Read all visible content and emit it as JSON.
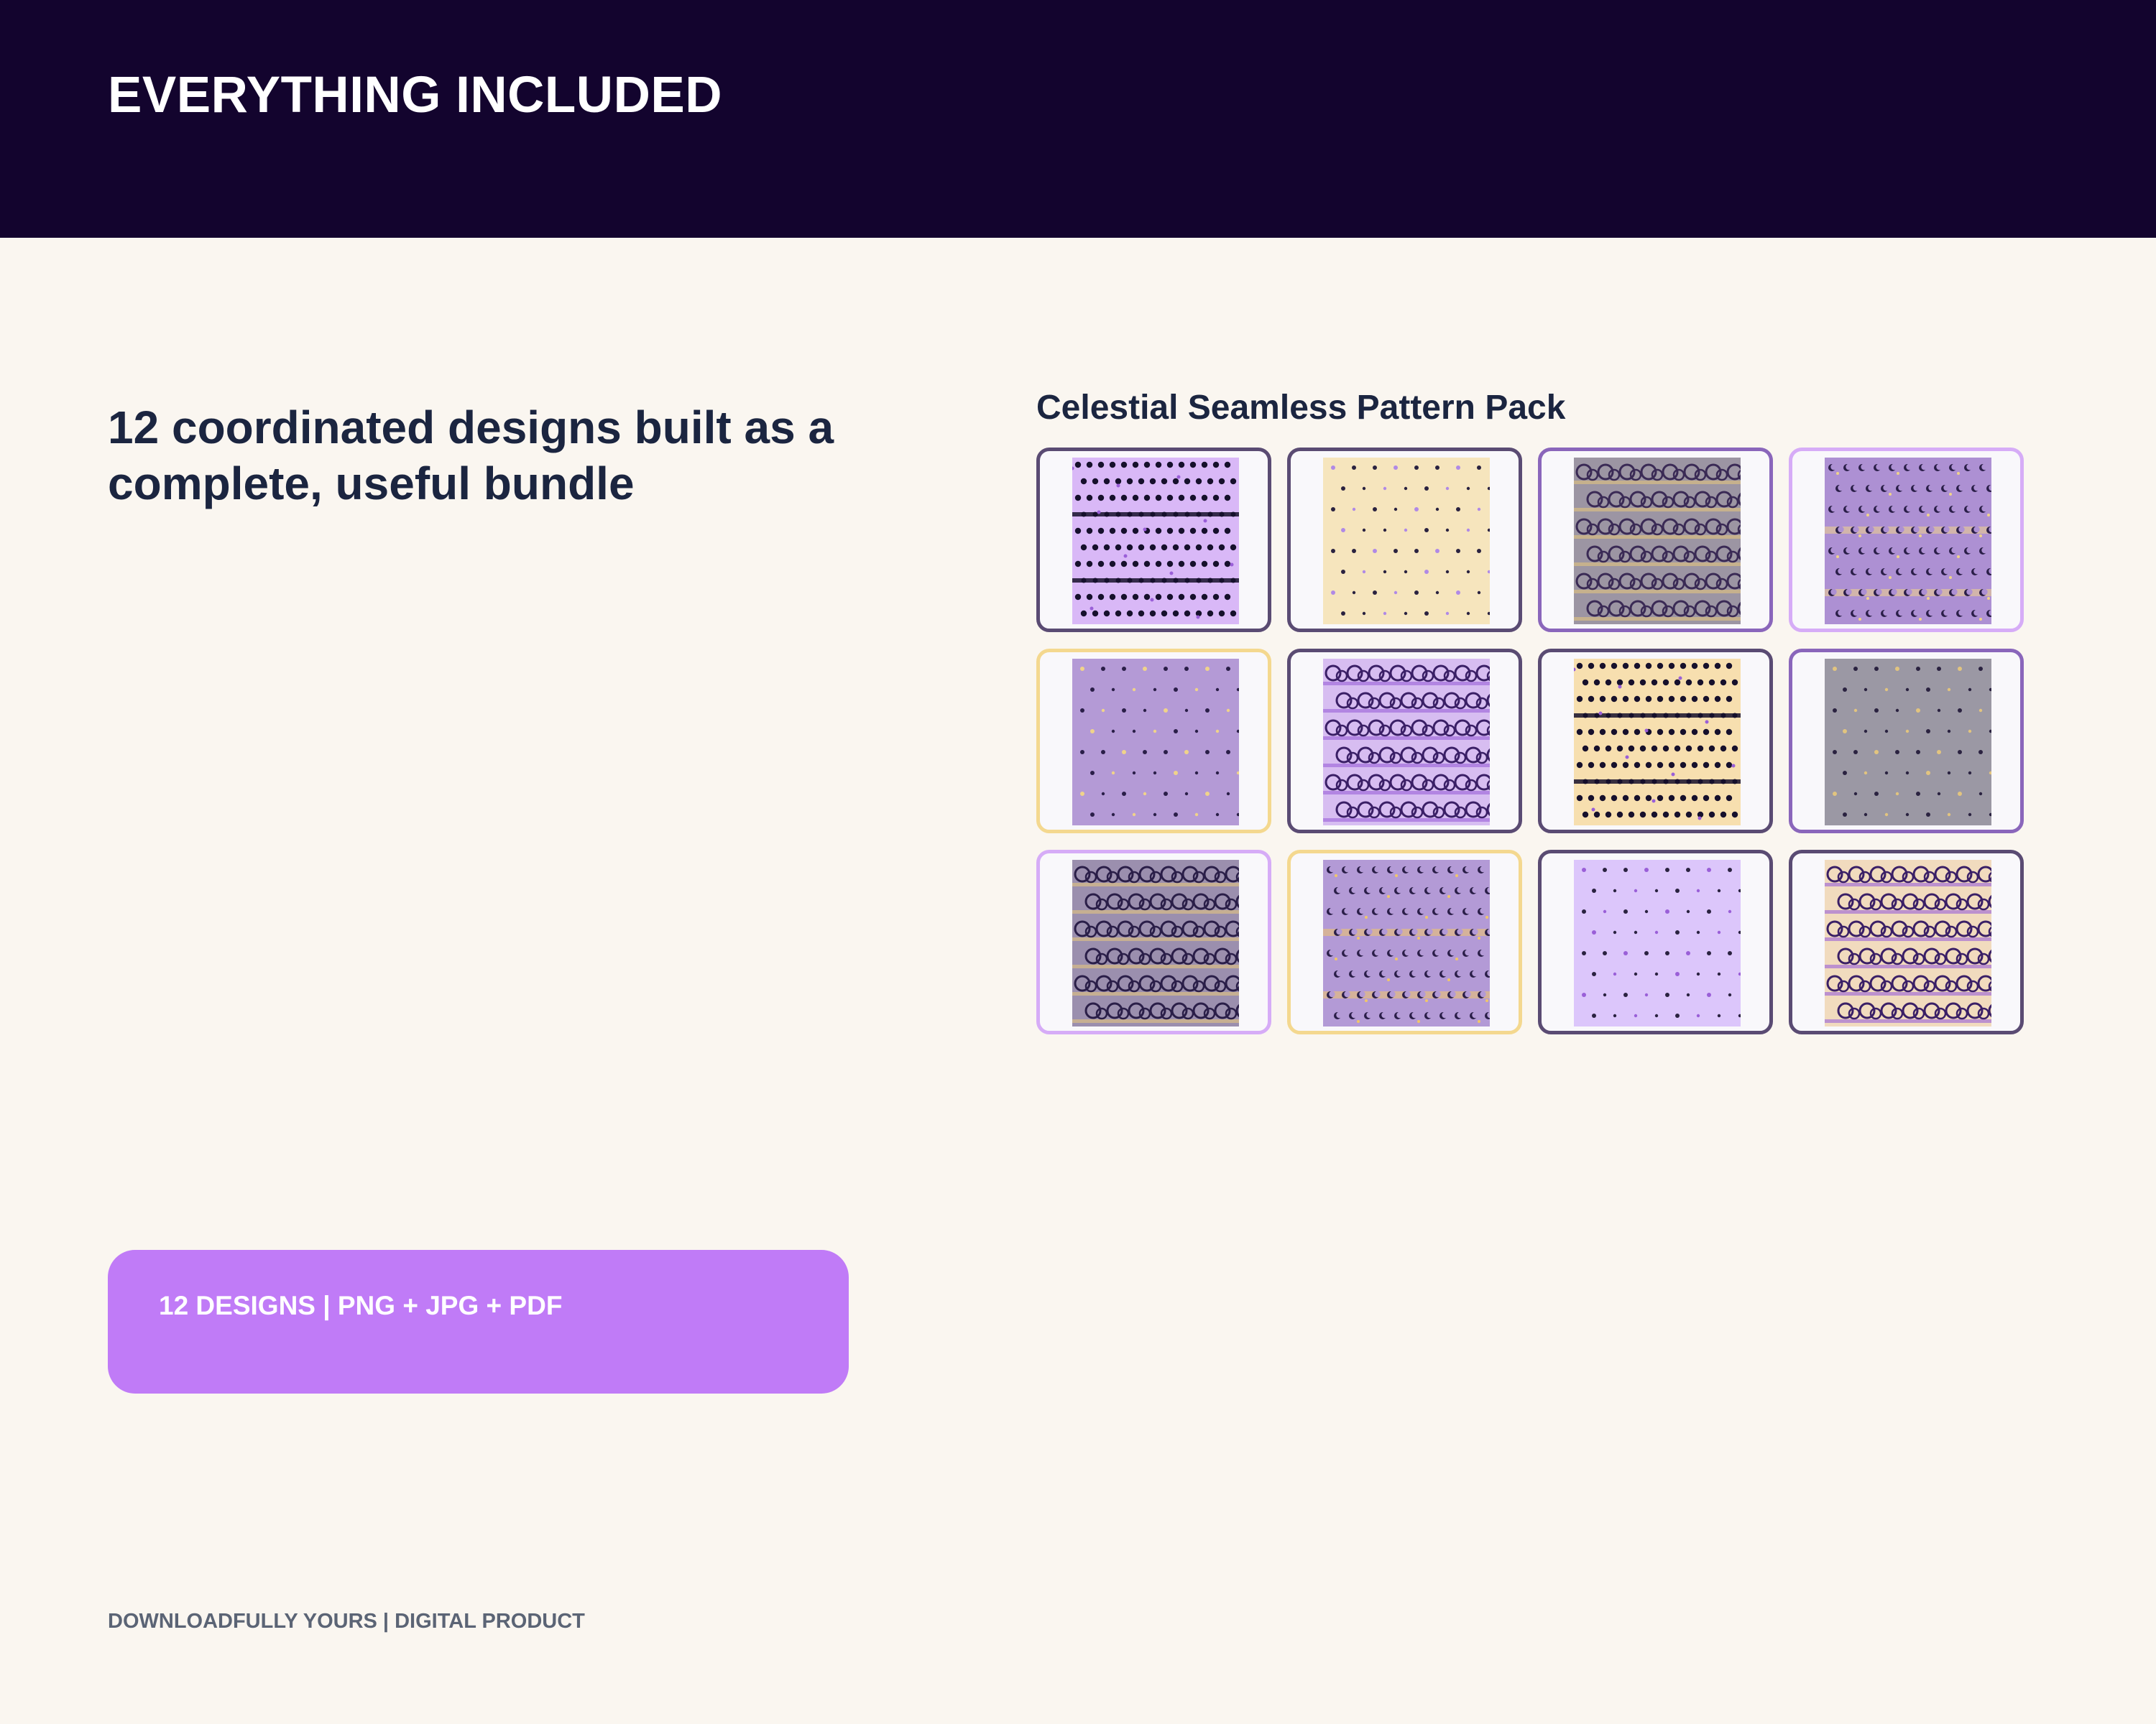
{
  "header": {
    "title": "EVERYTHING INCLUDED"
  },
  "headline": "12 coordinated designs built as a complete, useful bundle",
  "pack": {
    "title": "Celestial Seamless Pattern Pack",
    "patterns": [
      {
        "style": "dots-bands",
        "bg": "#d9b8f7",
        "ink": "#16102c",
        "accent": "#9a5fd8",
        "frame": "#5a4b73"
      },
      {
        "style": "sparse",
        "bg": "#f6e5bd",
        "ink": "#2a2240",
        "accent": "#b089e6",
        "frame": "#5a4b73"
      },
      {
        "style": "rings",
        "bg": "#9c95a3",
        "ink": "#3a2a55",
        "accent": "#e2c47f",
        "frame": "#8a66bb"
      },
      {
        "style": "moons",
        "bg": "#ad90d3",
        "ink": "#2a1e48",
        "accent": "#f0d38a",
        "frame": "#d6acf7"
      },
      {
        "style": "sparse",
        "bg": "#b49ad6",
        "ink": "#2a1e48",
        "accent": "#f0d38a",
        "frame": "#f4d88f"
      },
      {
        "style": "rings",
        "bg": "#d7bdf1",
        "ink": "#3a1f66",
        "accent": "#9a5fd8",
        "frame": "#5a4b73"
      },
      {
        "style": "dots-bands",
        "bg": "#f7dfaf",
        "ink": "#16102c",
        "accent": "#9a5fd8",
        "frame": "#5a4b73"
      },
      {
        "style": "sparse",
        "bg": "#9b98a4",
        "ink": "#2a2240",
        "accent": "#e2c47f",
        "frame": "#8a66bb"
      },
      {
        "style": "rings",
        "bg": "#9b8fae",
        "ink": "#2a1e48",
        "accent": "#e2c47f",
        "frame": "#d6acf7"
      },
      {
        "style": "moons",
        "bg": "#b39ad6",
        "ink": "#2a1e48",
        "accent": "#f0c66a",
        "frame": "#f4d88f"
      },
      {
        "style": "sparse",
        "bg": "#dcc6fb",
        "ink": "#2a2240",
        "accent": "#9a5fd8",
        "frame": "#5a4b73"
      },
      {
        "style": "rings",
        "bg": "#f1dbbe",
        "ink": "#3a1f66",
        "accent": "#9a5fd8",
        "frame": "#5a4b73"
      }
    ]
  },
  "formats_label": "12 DESIGNS | PNG + JPG + PDF",
  "footer": "DOWNLOADFULLY YOURS | DIGITAL PRODUCT",
  "colors": {
    "header_bg": "#13042e",
    "page_bg": "#faf6f0",
    "text_dark": "#1b2540",
    "badge_bg": "#c07bf7",
    "footer_text": "#5b6475"
  }
}
